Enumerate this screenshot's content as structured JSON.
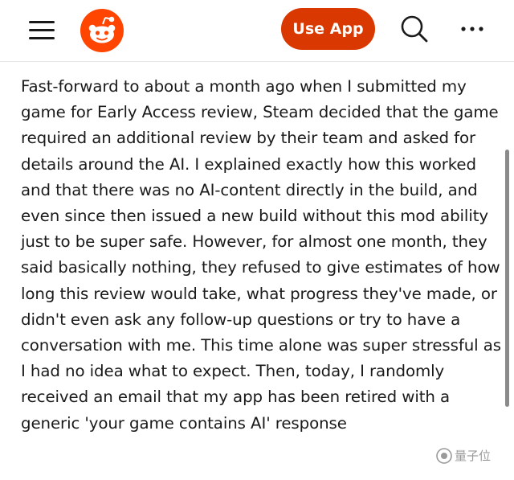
{
  "header": {
    "menu_icon": "hamburger-menu-icon",
    "logo_icon": "reddit-snoo-logo",
    "use_app_label": "Use App",
    "search_icon": "search-icon",
    "more_icon": "more-horizontal-icon",
    "brand_color": "#ff4500",
    "button_color": "#d93900"
  },
  "post": {
    "body": "Fast-forward to about a month ago when I submitted my game for Early Access review, Steam decided that the game required an additional review by their team and asked for details around the AI. I explained exactly how this worked and that there was no AI-content directly in the build, and even since then issued a new build without this mod ability just to be super safe. However, for almost one month, they said basically nothing, they refused to give estimates of how long this review would take, what progress they've made, or didn't even ask any follow-up questions or try to have a conversation with me. This time alone was super stressful as I had no idea what to expect. Then, today, I randomly received an email that my app has been retired with a generic 'your game contains AI' response"
  },
  "watermark": {
    "text": "量子位"
  }
}
